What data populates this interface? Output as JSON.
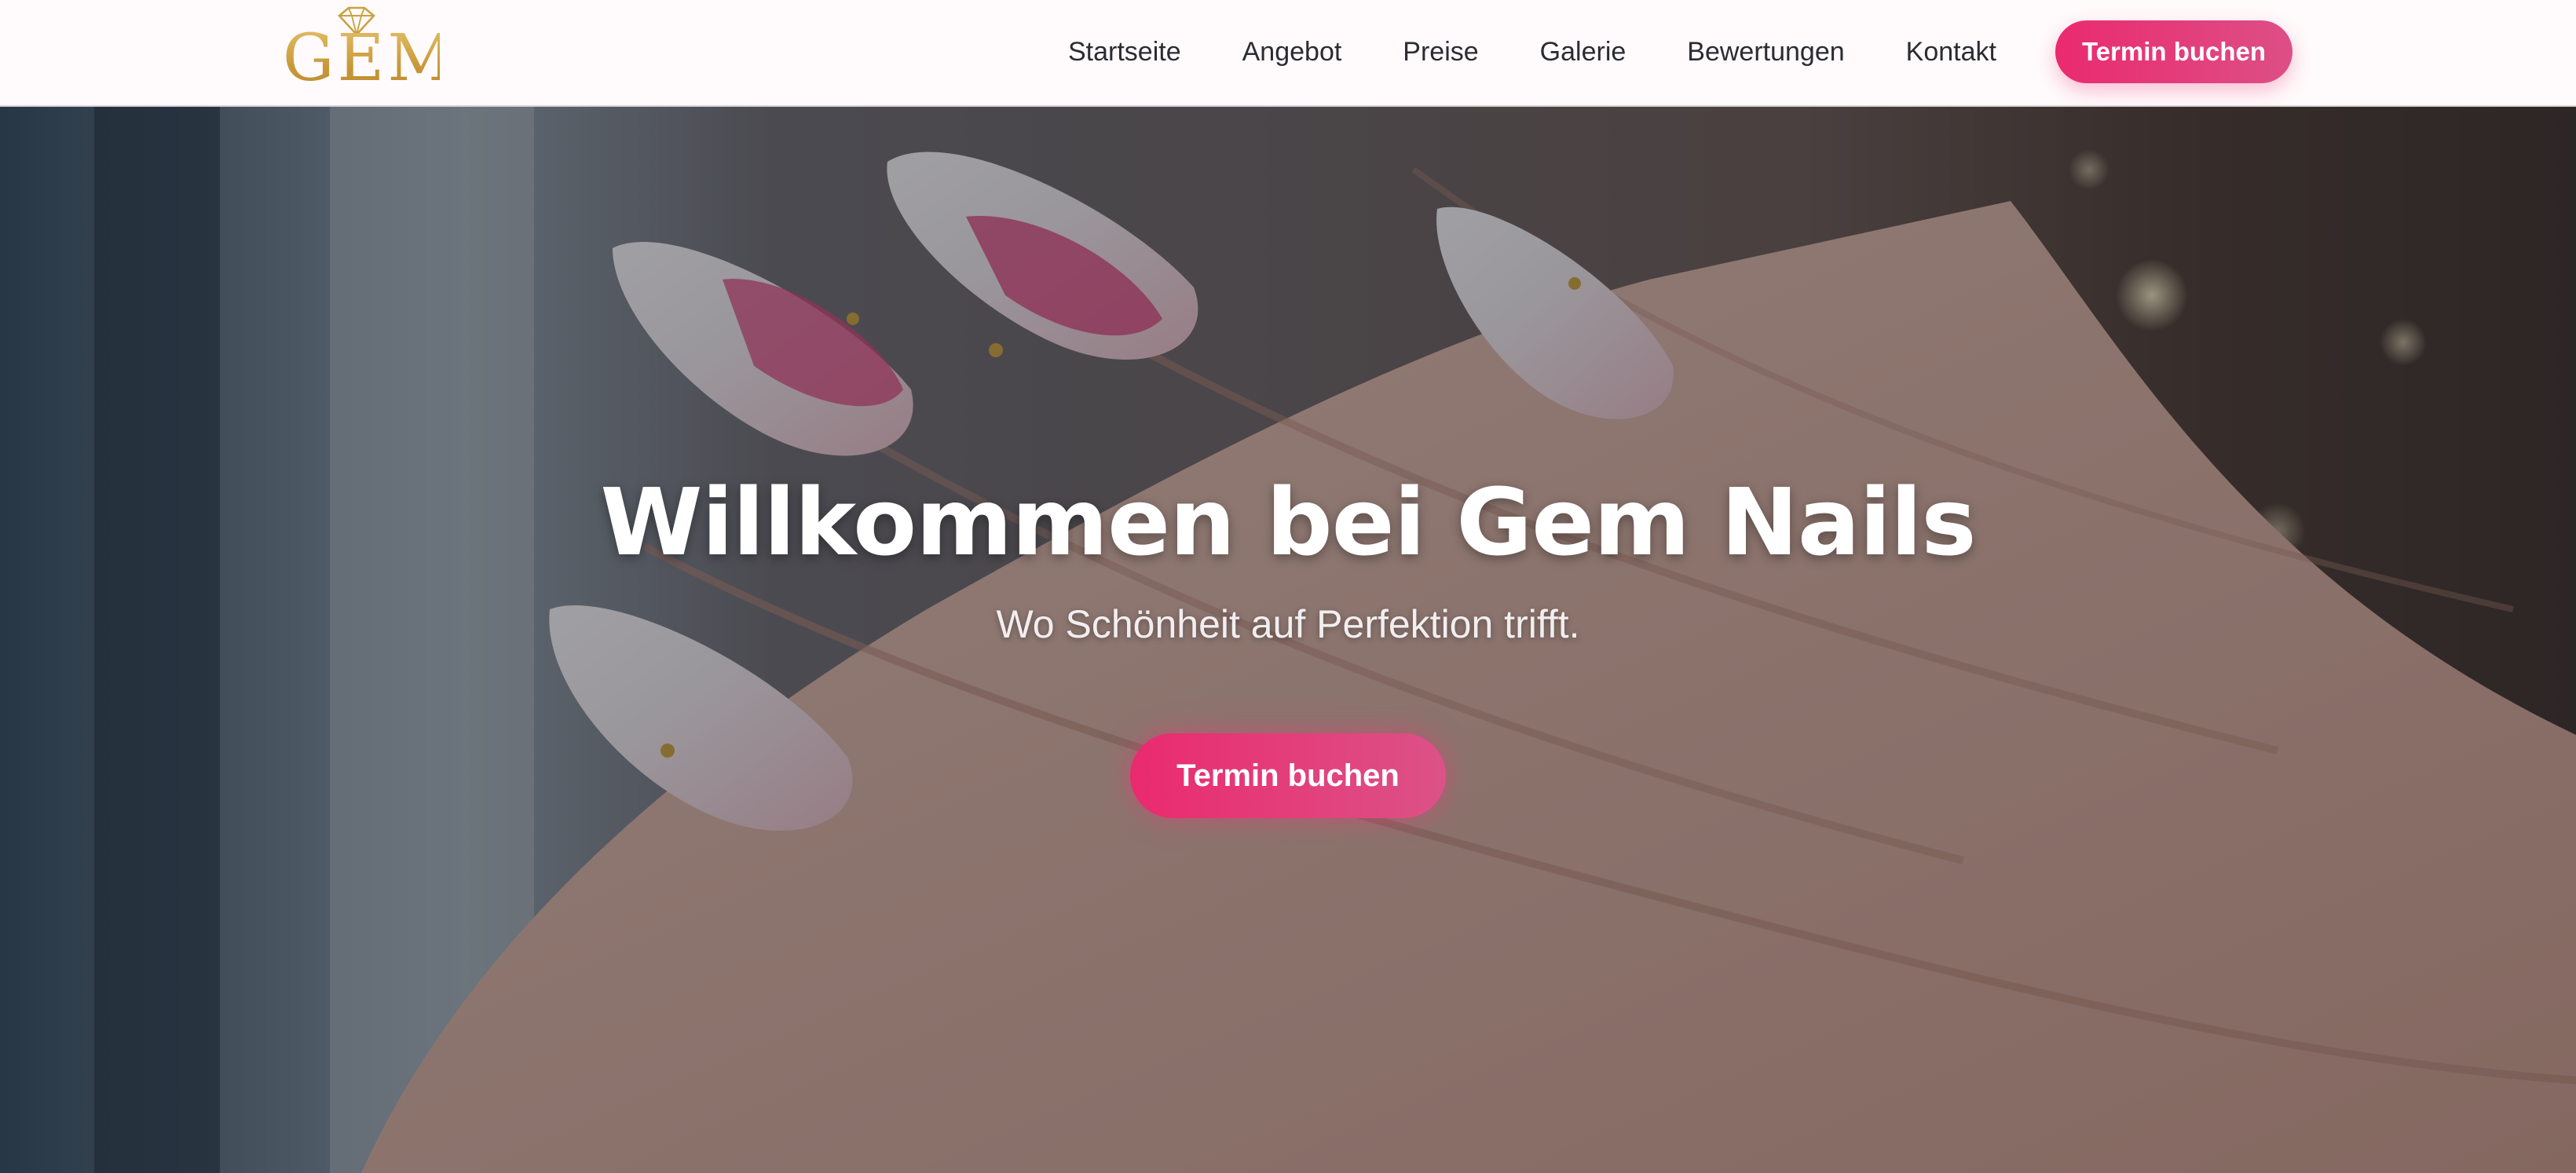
{
  "brand": {
    "logo_text": "GEM",
    "logo_icon": "diamond-icon",
    "gold_color": "#c9a13e"
  },
  "nav": {
    "links": [
      {
        "label": "Startseite"
      },
      {
        "label": "Angebot"
      },
      {
        "label": "Preise"
      },
      {
        "label": "Galerie"
      },
      {
        "label": "Bewertungen"
      },
      {
        "label": "Kontakt"
      }
    ],
    "cta_label": "Termin buchen"
  },
  "hero": {
    "title": "Willkommen bei Gem Nails",
    "subtitle": "Wo Schönheit auf Perfektion trifft.",
    "cta_label": "Termin buchen"
  },
  "colors": {
    "accent": "#ea2a6e",
    "accent_light": "#dd4f86",
    "nav_text": "#2b2b33"
  }
}
